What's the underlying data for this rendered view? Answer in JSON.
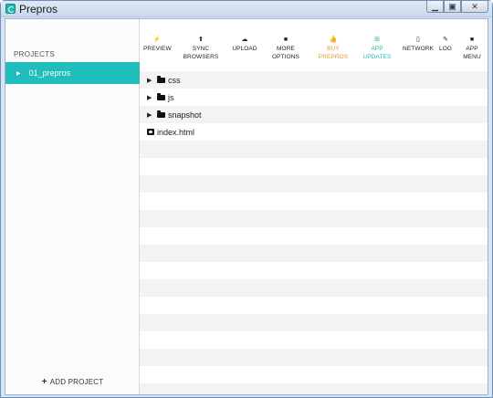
{
  "window": {
    "title": "Prepros",
    "controls": {
      "minimize": "▁",
      "maximize": "▣",
      "close": "✕"
    }
  },
  "sidebar": {
    "heading": "PROJECTS",
    "projects": [
      {
        "name": "01_prepros",
        "selected": true
      }
    ],
    "add_project": "ADD PROJECT",
    "accent": "#1fbdbc"
  },
  "toolbar": {
    "items": [
      {
        "line1": "PREVIEW",
        "line2": "",
        "icon": "bolt-icon",
        "glyph": "⚡"
      },
      {
        "line1": "SYNC",
        "line2": "BROWSERS",
        "icon": "sync-icon",
        "glyph": "⬆"
      },
      {
        "line1": "UPLOAD",
        "line2": "",
        "icon": "upload-icon",
        "glyph": "☁"
      },
      {
        "line1": "MORE",
        "line2": "OPTIONS",
        "icon": "options-icon",
        "glyph": "■"
      },
      {
        "line1": "BUY",
        "line2": "PREPROS",
        "icon": "thumbs-up-icon",
        "glyph": "👍",
        "color": "#e39a2b"
      },
      {
        "line1": "APP",
        "line2": "UPDATES",
        "icon": "gift-icon",
        "glyph": "⊞",
        "color": "#24b8b3"
      },
      {
        "line1": "NETWORK",
        "line2": "",
        "icon": "mobile-icon",
        "glyph": "▯"
      },
      {
        "line1": "LOG",
        "line2": "",
        "icon": "pencil-icon",
        "glyph": "✎"
      },
      {
        "line1": "APP",
        "line2": "MENU",
        "icon": "menu-icon",
        "glyph": "■"
      }
    ]
  },
  "files": [
    {
      "name": "css",
      "type": "folder"
    },
    {
      "name": "js",
      "type": "folder"
    },
    {
      "name": "snapshot",
      "type": "folder"
    },
    {
      "name": "index.html",
      "type": "file"
    }
  ]
}
